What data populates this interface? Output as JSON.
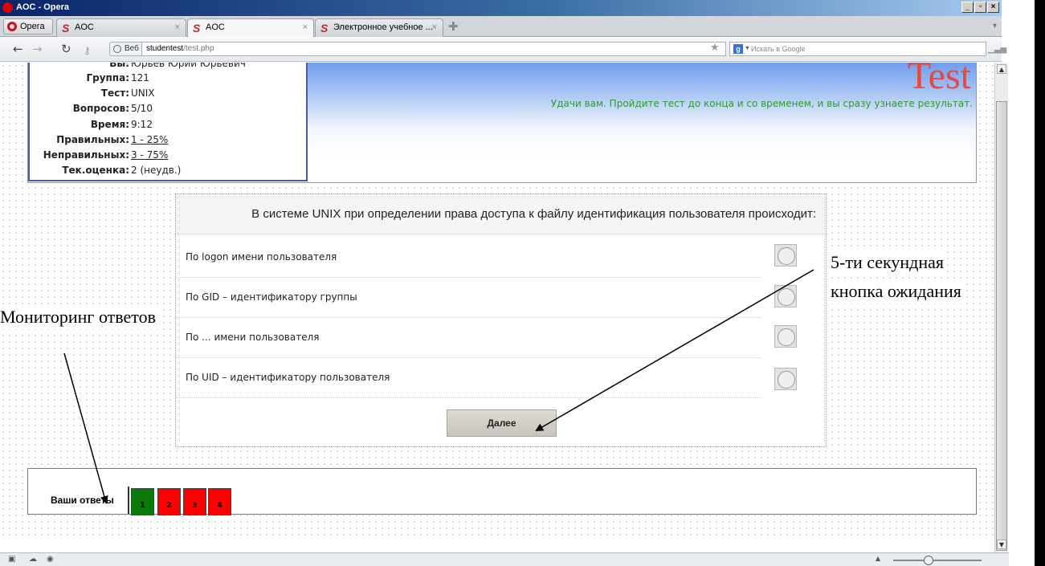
{
  "window": {
    "title": "AOC - Opera"
  },
  "tabs": [
    {
      "label": "AOC",
      "active": false
    },
    {
      "label": "AOC",
      "active": true
    },
    {
      "label": "Электронное учебное ...",
      "active": false
    }
  ],
  "opera_button": "Opera",
  "address": {
    "badge": "Веб",
    "host": "studentest",
    "path": "/test.php",
    "search_placeholder": "Искать в Google"
  },
  "info": {
    "you_label": "Вы:",
    "you_value": "Юрьев Юрий Юрьевич",
    "group_label": "Группа:",
    "group_value": "121",
    "test_label": "Тест:",
    "test_value": "UNIX",
    "questions_label": "Вопросов:",
    "questions_value": "5/10",
    "time_label": "Время:",
    "time_value": "9:12",
    "correct_label": "Правильных:",
    "correct_value": "1 - 25%",
    "wrong_label": "Неправильных:",
    "wrong_value": "3 - 75%",
    "grade_label": "Тек.оценка:",
    "grade_value": "2 (неудв.)"
  },
  "header": {
    "logo": "Test",
    "wish": "Удачи вам. Пройдите тест до конца и со временем, и вы сразу узнаете результат."
  },
  "question": {
    "text": "В системе UNIX при определении права доступа к файлу идентификация пользователя происходит:",
    "answers": [
      "По logon имени пользователя",
      "По GID – идентификатору группы",
      "По ... имени пользователя",
      "По UID – идентификатору пользователя"
    ],
    "next_label": "Далее"
  },
  "answers_panel": {
    "label": "Ваши ответы",
    "items": [
      {
        "n": "1",
        "color": "#0a7a0a"
      },
      {
        "n": "2",
        "color": "#ff0000"
      },
      {
        "n": "3",
        "color": "#ff0000"
      },
      {
        "n": "4",
        "color": "#ff0000"
      }
    ]
  },
  "annotations": {
    "monitor": "Мониторинг ответов",
    "wait_line1": "5-ти секундная",
    "wait_line2": "кнопка ожидания"
  }
}
